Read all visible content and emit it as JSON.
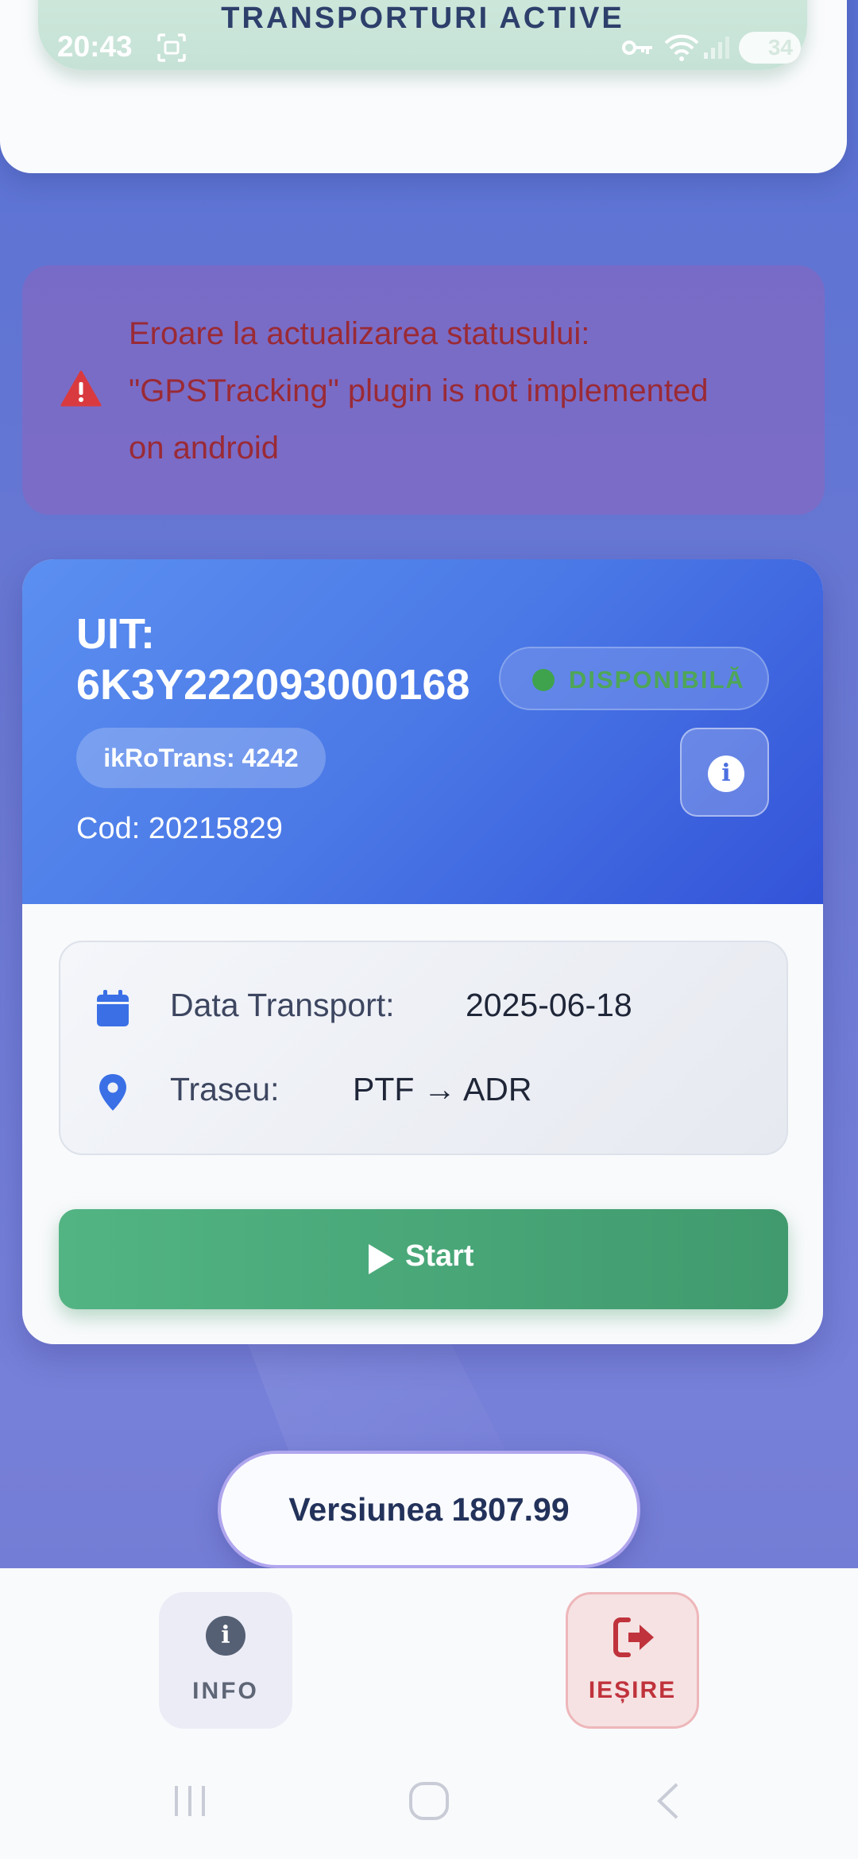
{
  "status_bar": {
    "time": "20:43",
    "battery": "34",
    "icons": [
      "screenshot-icon",
      "vpn-key-icon",
      "wifi-icon",
      "signal-icon",
      "battery-icon"
    ]
  },
  "header": {
    "title": "TRANSPORTURI ACTIVE"
  },
  "error": {
    "line1": "Eroare la actualizarea statusului:",
    "line2": "\"GPSTracking\" plugin is not implemented",
    "line3": "on android",
    "icon": "warning-icon"
  },
  "transport": {
    "uit_label": "UIT:",
    "uit_value": "6K3Y222093000168",
    "status": "DISPONIBILĂ",
    "company": "ikRoTrans: 4242",
    "code": "Cod: 20215829",
    "date_label": "Data Transport:",
    "date_value": "2025-06-18",
    "route_label": "Traseu:",
    "route_value": "PTF → ADR",
    "start_label": "Start",
    "colors": {
      "header_start": "#5b8ff0",
      "header_end": "#3353d8",
      "start_button": "#4aa878",
      "status_green": "#3fa34d"
    }
  },
  "version": {
    "label": "Versiunea 1807.99"
  },
  "bottom_nav": {
    "info_label": "INFO",
    "exit_label": "IEȘIRE",
    "exit_color": "#c0333c"
  }
}
